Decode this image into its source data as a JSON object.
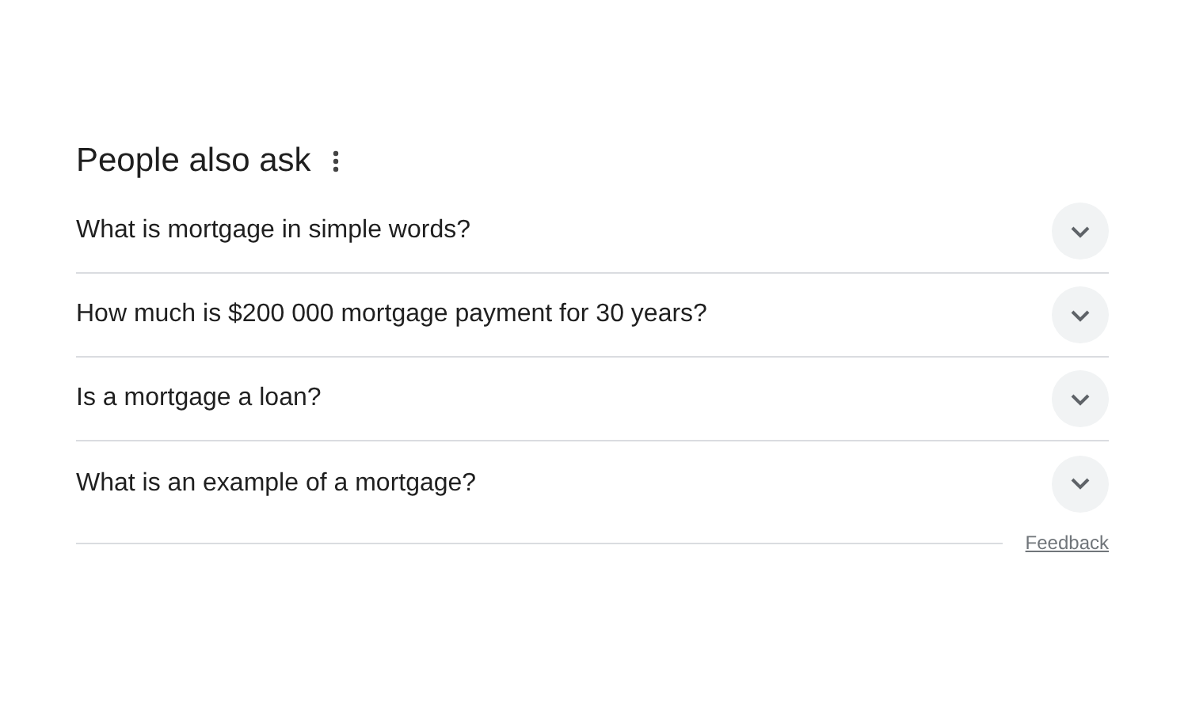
{
  "section": {
    "title": "People also ask"
  },
  "questions": [
    {
      "text": "What is mortgage in simple words?",
      "expanded": false
    },
    {
      "text": "How much is $200 000 mortgage payment for 30 years?",
      "expanded": false
    },
    {
      "text": "Is a mortgage a loan?",
      "expanded": false
    },
    {
      "text": "What is an example of a mortgage?",
      "expanded": false
    }
  ],
  "footer": {
    "link": "Feedback"
  }
}
